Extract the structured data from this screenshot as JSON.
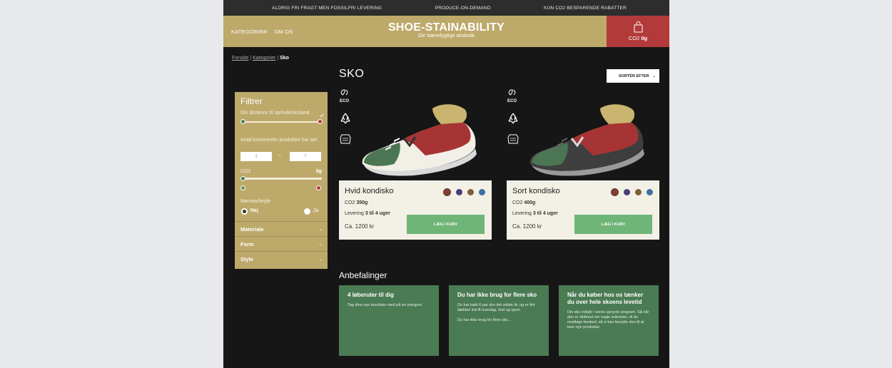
{
  "topbar": {
    "items": [
      "ALDRIG FRI FRAGT MEN FOSSILFRI LEVERING",
      "PRODUCE-ON-DEMAND",
      "KUN CO2 BESPARENDE RABATTER"
    ]
  },
  "header": {
    "nav": [
      "KATEGORIER",
      "OM OS"
    ],
    "brand_title": "SHOE-STAINABILITY",
    "brand_subtitle": "Din bæredygtige skobutik",
    "cart_label": "CO2",
    "cart_value": "0g"
  },
  "breadcrumb": {
    "home": "Forside",
    "category": "Kategorier",
    "current": "Sko"
  },
  "page_title": "SKO",
  "sort_label": "SORTÉR EFTER",
  "filter": {
    "title": "Filtrer",
    "distance_label": "Din distance til oprindelsesland",
    "continents_label": "Antal kontinenter produktet har set",
    "min_value": "1",
    "max_value": "7",
    "range_sep": "–",
    "co2_label": "CO2",
    "co2_value": "0g",
    "child_labor_label": "Børnearbejde",
    "no_label": "Nej",
    "yes_label": "Ja",
    "accordions": [
      "Materiale",
      "Form",
      "Style"
    ]
  },
  "colors": {
    "gold": "#bda96a",
    "red": "#b33a3a",
    "green": "#6fb577",
    "card_green": "#4b7b53"
  },
  "products": [
    {
      "name": "Hvid kondisko",
      "co2_label": "CO2",
      "co2": "350g",
      "delivery_label": "Levering",
      "delivery": "3 til 4 uger",
      "price": "Ca. 1200 kr",
      "button": "LÆG I KURV",
      "swatches": [
        "#8b3a32",
        "#4a3d78",
        "#7d5f34",
        "#3f6fa0"
      ]
    },
    {
      "name": "Sort kondisko",
      "co2_label": "CO2",
      "co2": "400g",
      "delivery_label": "Levering",
      "delivery": "3 til 4 uger",
      "price": "Ca. 1200 kr",
      "button": "LÆG I KURV",
      "swatches": [
        "#8b3a32",
        "#4a3d78",
        "#7d5f34",
        "#3f6fa0"
      ]
    }
  ],
  "product_icons": [
    "eco-icon",
    "recycle-icon",
    "leather-icon"
  ],
  "eco_text": "ECO",
  "recommendations": {
    "title": "Anbefalinger",
    "cards": [
      {
        "title": "4 løberuter til dig",
        "body": "Tag dine nye kondisko med på en svingom.",
        "body2": ""
      },
      {
        "title": "Du har ikke brug for flere sko",
        "body": "Du har købt 6 par sko det sidste år, og er fint dækket ind ift hverdag, fest og sport.",
        "body2": "Du har ikke brug for flere sko..."
      },
      {
        "title": "Når du køber hos os tænker du over hele skoens levetid",
        "body": "Din sko indgår i vores upcycle program. Så når den er slidtned om nogle måneder, vil du modtage besked, så vi kan benytte den til at lave nye produkter.",
        "body2": ""
      }
    ]
  }
}
